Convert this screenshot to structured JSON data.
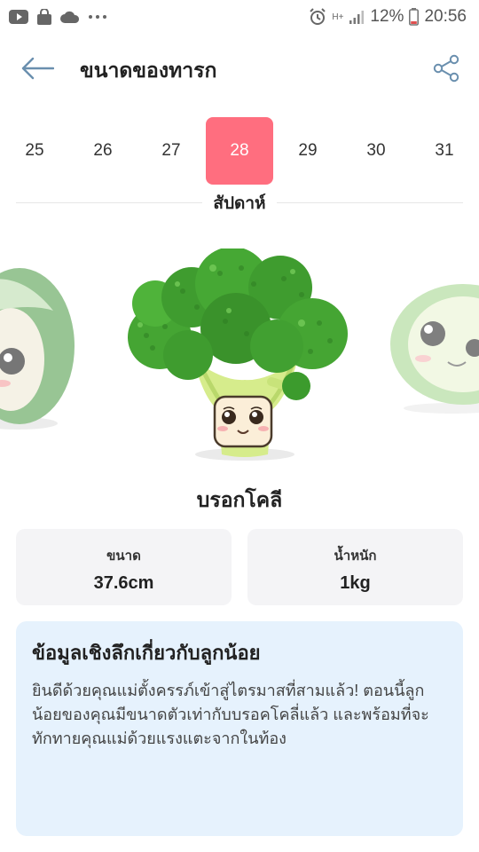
{
  "status_bar": {
    "network": "H+",
    "battery_percent": "12%",
    "time": "20:56",
    "icons": [
      "youtube-icon",
      "bag-icon",
      "cloud-icon",
      "more-dots-icon",
      "alarm-icon",
      "network-icon",
      "signal-icon",
      "battery-icon"
    ]
  },
  "header": {
    "title": "ขนาดของทารก",
    "back_icon": "back-arrow-icon",
    "share_icon": "share-icon"
  },
  "week_selector": {
    "weeks": [
      "25",
      "26",
      "27",
      "28",
      "29",
      "30",
      "31"
    ],
    "selected": "28",
    "unit_label": "สัปดาห์"
  },
  "carousel": {
    "items": [
      "avocado-illustration",
      "broccoli-illustration",
      "melon-illustration"
    ],
    "current": "broccoli-illustration"
  },
  "fruit": {
    "name": "บรอกโคลี"
  },
  "stats": {
    "size_label": "ขนาด",
    "size_value": "37.6cm",
    "weight_label": "น้ำหนัก",
    "weight_value": "1kg"
  },
  "insight": {
    "title": "ข้อมูลเชิงลึกเกี่ยวกับลูกน้อย",
    "body": "ยินดีด้วยคุณแม่ตั้งครรภ์เข้าสู่ไตรมาสที่สามแล้ว! ตอนนี้ลูกน้อยของคุณมีขนาดตัวเท่ากับบรอคโคลี่แล้ว และพร้อมที่จะทักทายคุณแม่ด้วยแรงแตะจากในท้อง"
  },
  "colors": {
    "accent": "#ff6e7f",
    "card_bg": "#f4f4f6",
    "info_bg": "#e6f2fd",
    "back_icon": "#6a8fae"
  }
}
